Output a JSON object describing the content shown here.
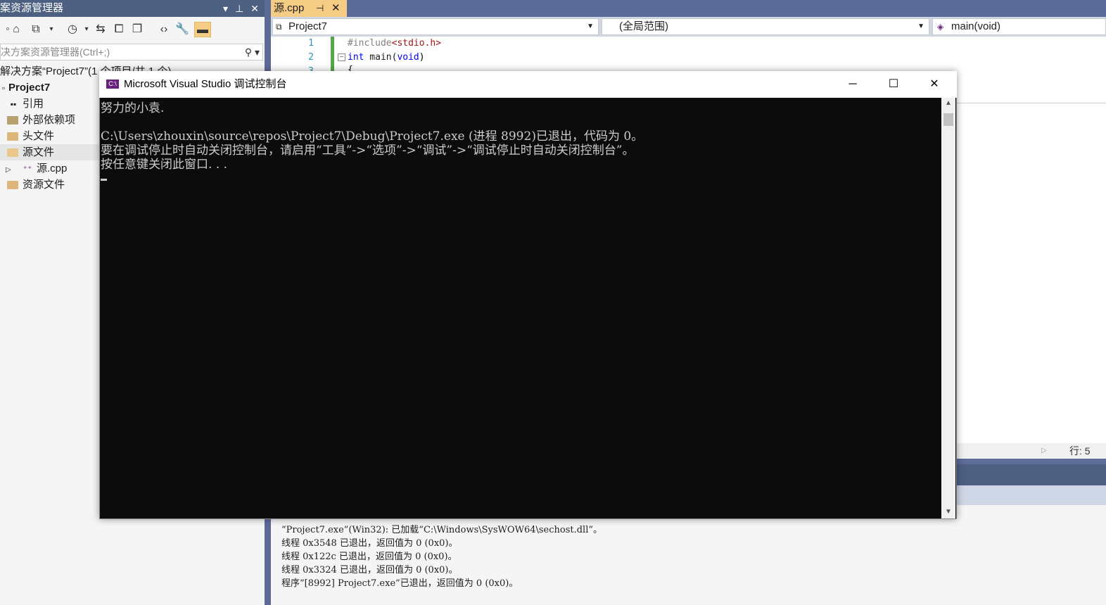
{
  "solution_explorer": {
    "title": "案资源管理器",
    "search_placeholder": "决方案资源管理器(Ctrl+;)",
    "solution_label": "解决方案“Project7”(1 个项目/共 1 个)",
    "project": "Project7",
    "items": [
      {
        "label": "引用",
        "icon": "references-icon"
      },
      {
        "label": "外部依赖项",
        "icon": "external-deps-icon"
      },
      {
        "label": "头文件",
        "icon": "folder-icon"
      },
      {
        "label": "源文件",
        "icon": "folder-open-icon"
      },
      {
        "label": "源.cpp",
        "icon": "cpp-file-icon"
      },
      {
        "label": "资源文件",
        "icon": "folder-icon"
      }
    ]
  },
  "editor": {
    "tab_label": "源.cpp",
    "project_combo": "Project7",
    "scope_combo": "(全局范围)",
    "member_combo": "main(void)",
    "line_numbers": [
      "1",
      "2",
      "3"
    ],
    "code": {
      "line1_directive": "#include",
      "line1_header": "<stdio.h>",
      "line2_kw": "int",
      "line2_fn": " main(",
      "line2_void": "void",
      "line2_close": ")",
      "line3": "{"
    },
    "status_line": "行: 5"
  },
  "output": {
    "lines": [
      "“Project7.exe”(Win32): 已加载“C:\\Windows\\SysWOW64\\sechost.dll”。",
      "线程 0x3548 已退出，返回值为 0 (0x0)。",
      "线程 0x122c 已退出，返回值为 0 (0x0)。",
      "线程 0x3324 已退出，返回值为 0 (0x0)。",
      "程序“[8992] Project7.exe”已退出，返回值为 0 (0x0)。"
    ]
  },
  "console": {
    "title": "Microsoft Visual Studio 调试控制台",
    "icon_text": "C:\\",
    "lines": [
      "努力的小袁.",
      "",
      "C:\\Users\\zhouxin\\source\\repos\\Project7\\Debug\\Project7.exe (进程 8992)已退出，代码为 0。",
      "要在调试停止时自动关闭控制台，请启用“工具”->“选项”->“调试”->“调试停止时自动关闭控制台”。",
      "按任意键关闭此窗口. . ."
    ]
  }
}
